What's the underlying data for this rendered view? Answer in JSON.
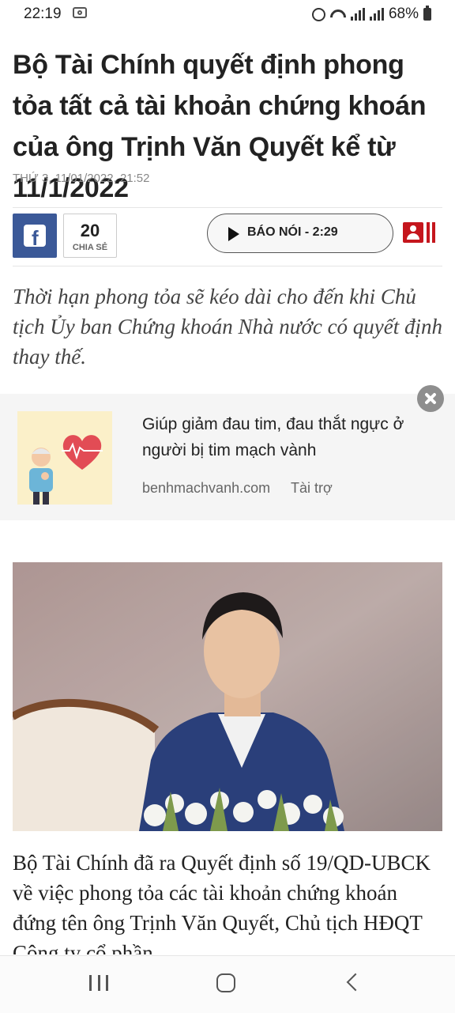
{
  "status_bar": {
    "time": "22:19",
    "battery": "68%",
    "icons": [
      "photo-icon",
      "alarm-icon",
      "wifi-icon",
      "signal-icon",
      "battery-icon"
    ]
  },
  "article": {
    "title": "Bộ Tài Chính quyết định phong tỏa tất cả tài khoản chứng khoán của ông Trịnh Văn Quyết kể từ 11/1/2022",
    "date": "THỨ 3, 11/01/2022, 21:52",
    "share": {
      "count": "20",
      "label": "CHIA SẺ"
    },
    "audio_label": "BÁO NÓI - 2:29",
    "lead": "Thời hạn phong tỏa sẽ kéo dài cho đến khi Chủ tịch Ủy ban Chứng khoán Nhà nước có quyết định thay thế.",
    "body": "Bộ Tài Chính đã ra Quyết định số 19/QD-UBCK về việc phong tỏa các tài khoản chứng khoán đứng tên ông Trịnh Văn Quyết, Chủ tịch HĐQT Công ty cổ phần"
  },
  "ad": {
    "text": "Giúp giảm đau tim, đau thắt ngực ở người bị tim mạch vành",
    "source": "benhmachvanh.com",
    "sponsor": "Tài trợ"
  },
  "colors": {
    "facebook": "#3b5998",
    "podcast_red": "#c5161d",
    "ad_background": "#f5f5f5"
  },
  "nav_icons": [
    "recent-apps-icon",
    "home-icon",
    "back-icon"
  ]
}
